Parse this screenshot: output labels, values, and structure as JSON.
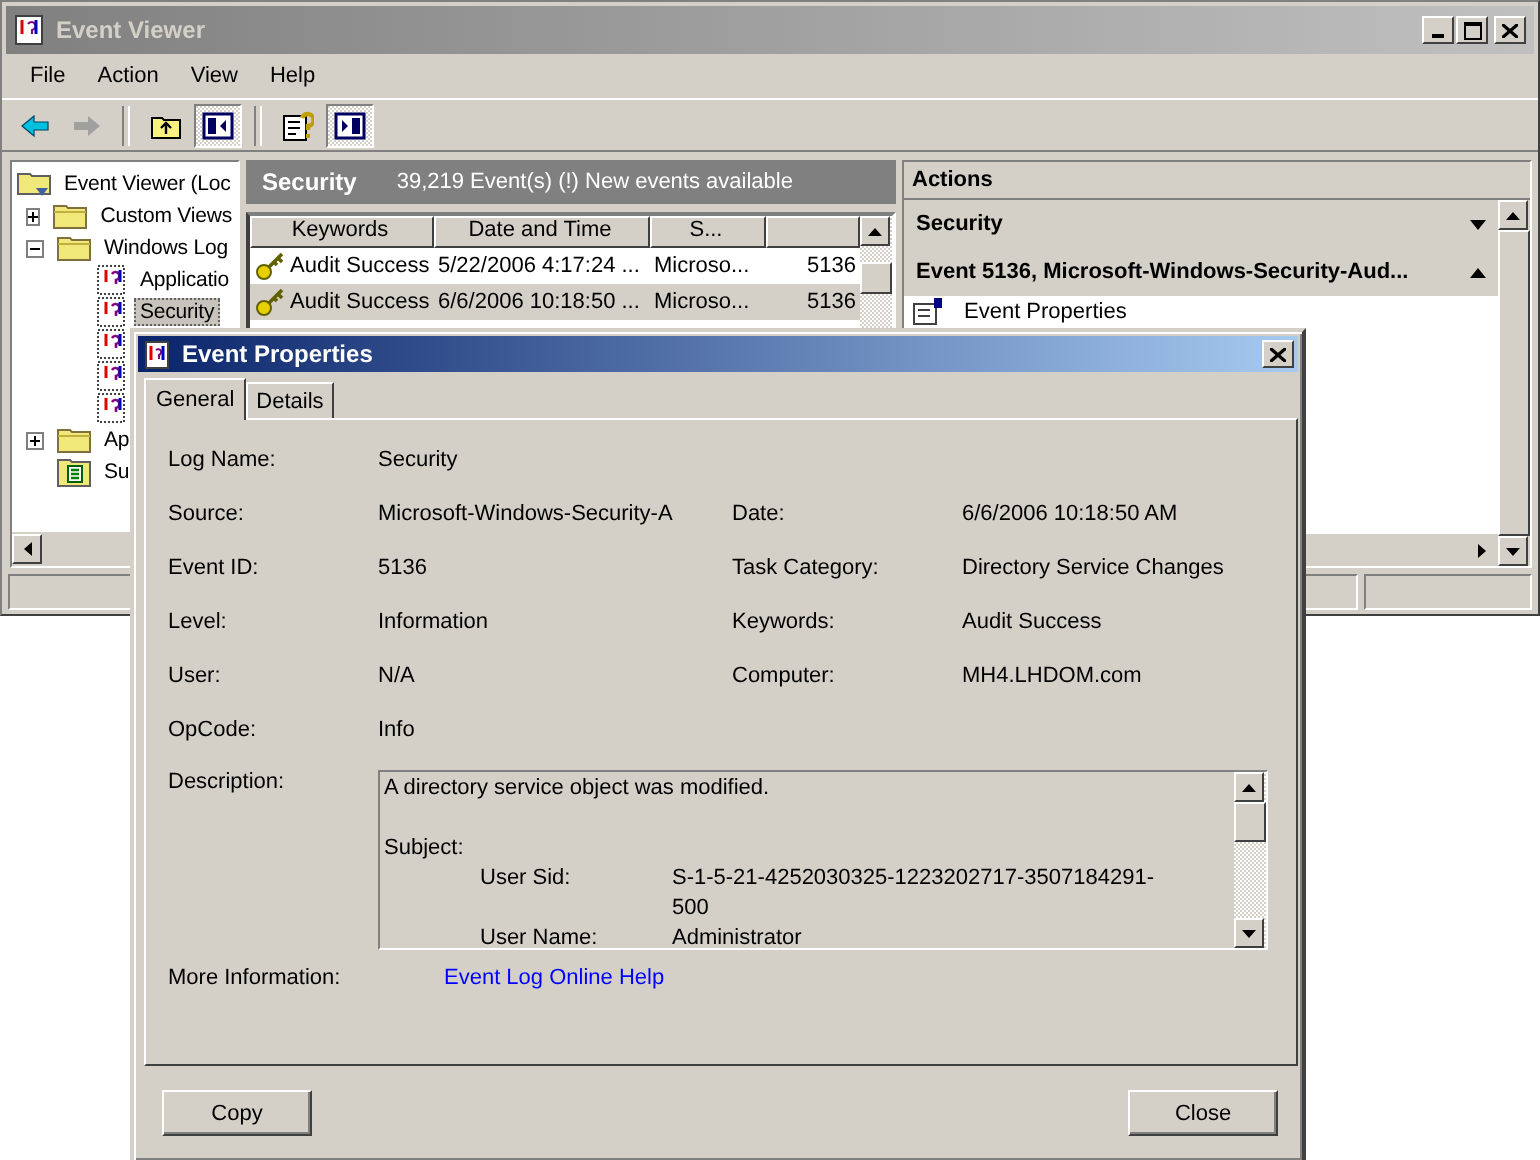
{
  "window": {
    "title": "Event Viewer",
    "active": false
  },
  "menu": [
    "File",
    "Action",
    "View",
    "Help"
  ],
  "toolbar": [
    {
      "kind": "back",
      "disabled": false,
      "pressed": false
    },
    {
      "kind": "forward",
      "disabled": true,
      "pressed": false
    },
    {
      "kind": "separator"
    },
    {
      "kind": "up-folder",
      "pressed": false
    },
    {
      "kind": "tree-pane",
      "pressed": true
    },
    {
      "kind": "separator"
    },
    {
      "kind": "help",
      "pressed": false
    },
    {
      "kind": "action-pane",
      "pressed": true
    }
  ],
  "tree": [
    {
      "label": "Event Viewer (Loc",
      "kind": "root",
      "selected": false,
      "children": [
        {
          "label": "Custom Views",
          "kind": "folder",
          "expanded": false,
          "selected": false
        },
        {
          "label": "Windows Log",
          "kind": "folder",
          "expanded": true,
          "selected": false,
          "children": [
            {
              "label": "Applicatio",
              "kind": "log",
              "selected": false
            },
            {
              "label": "Security",
              "kind": "log",
              "selected": true
            },
            {
              "kind": "log"
            },
            {
              "kind": "log"
            },
            {
              "kind": "log"
            }
          ]
        },
        {
          "label": "Ap",
          "kind": "folder",
          "expanded": false,
          "selected": false
        },
        {
          "label": "Su",
          "kind": "subscription",
          "selected": false
        }
      ]
    }
  ],
  "events": {
    "title": "Security",
    "summary": "39,219 Event(s) (!) New events available",
    "columns": [
      "Keywords",
      "Date and Time",
      "S..."
    ],
    "rows": [
      {
        "keywords": "Audit Success",
        "date": "5/22/2006 4:17:24 ...",
        "source": "Microso...",
        "event_id": "5136",
        "selected": false
      },
      {
        "keywords": "Audit Success",
        "date": "6/6/2006 10:18:50 ...",
        "source": "Microso...",
        "event_id": "5136",
        "selected": true
      }
    ]
  },
  "actions": {
    "title": "Actions",
    "sections": [
      {
        "label": "Security",
        "expanded": false
      },
      {
        "label": "Event 5136, Microsoft-Windows-Security-Aud...",
        "expanded": true,
        "items": [
          {
            "label": "Event Properties"
          }
        ]
      }
    ]
  },
  "dialog": {
    "title": "Event Properties",
    "tabs": [
      {
        "label": "General",
        "selected": true
      },
      {
        "label": "Details",
        "selected": false
      }
    ],
    "fields": [
      [
        {
          "label": "Log Name:",
          "value": "Security"
        }
      ],
      [
        {
          "label": "Source:",
          "value": "Microsoft-Windows-Security-A"
        },
        {
          "label": "Date:",
          "value": "6/6/2006 10:18:50 AM"
        }
      ],
      [
        {
          "label": "Event ID:",
          "value": "5136"
        },
        {
          "label": "Task Category:",
          "value": "Directory Service Changes"
        }
      ],
      [
        {
          "label": "Level:",
          "value": "Information"
        },
        {
          "label": "Keywords:",
          "value": "Audit Success"
        }
      ],
      [
        {
          "label": "User:",
          "value": "N/A"
        },
        {
          "label": "Computer:",
          "value": "MH4.LHDOM.com"
        }
      ],
      [
        {
          "label": "OpCode:",
          "value": "Info"
        }
      ]
    ],
    "description": {
      "label": "Description:",
      "text": "A directory service object was modified.",
      "heading": "Subject:",
      "items": [
        {
          "name": "User Sid:",
          "value": "S-1-5-21-4252030325-1223202717-3507184291-500"
        },
        {
          "name": "User Name:",
          "value": "Administrator"
        }
      ]
    },
    "more_info": {
      "label": "More Information:",
      "link": "Event Log Online Help"
    },
    "buttons": [
      "Copy",
      "Close"
    ]
  }
}
